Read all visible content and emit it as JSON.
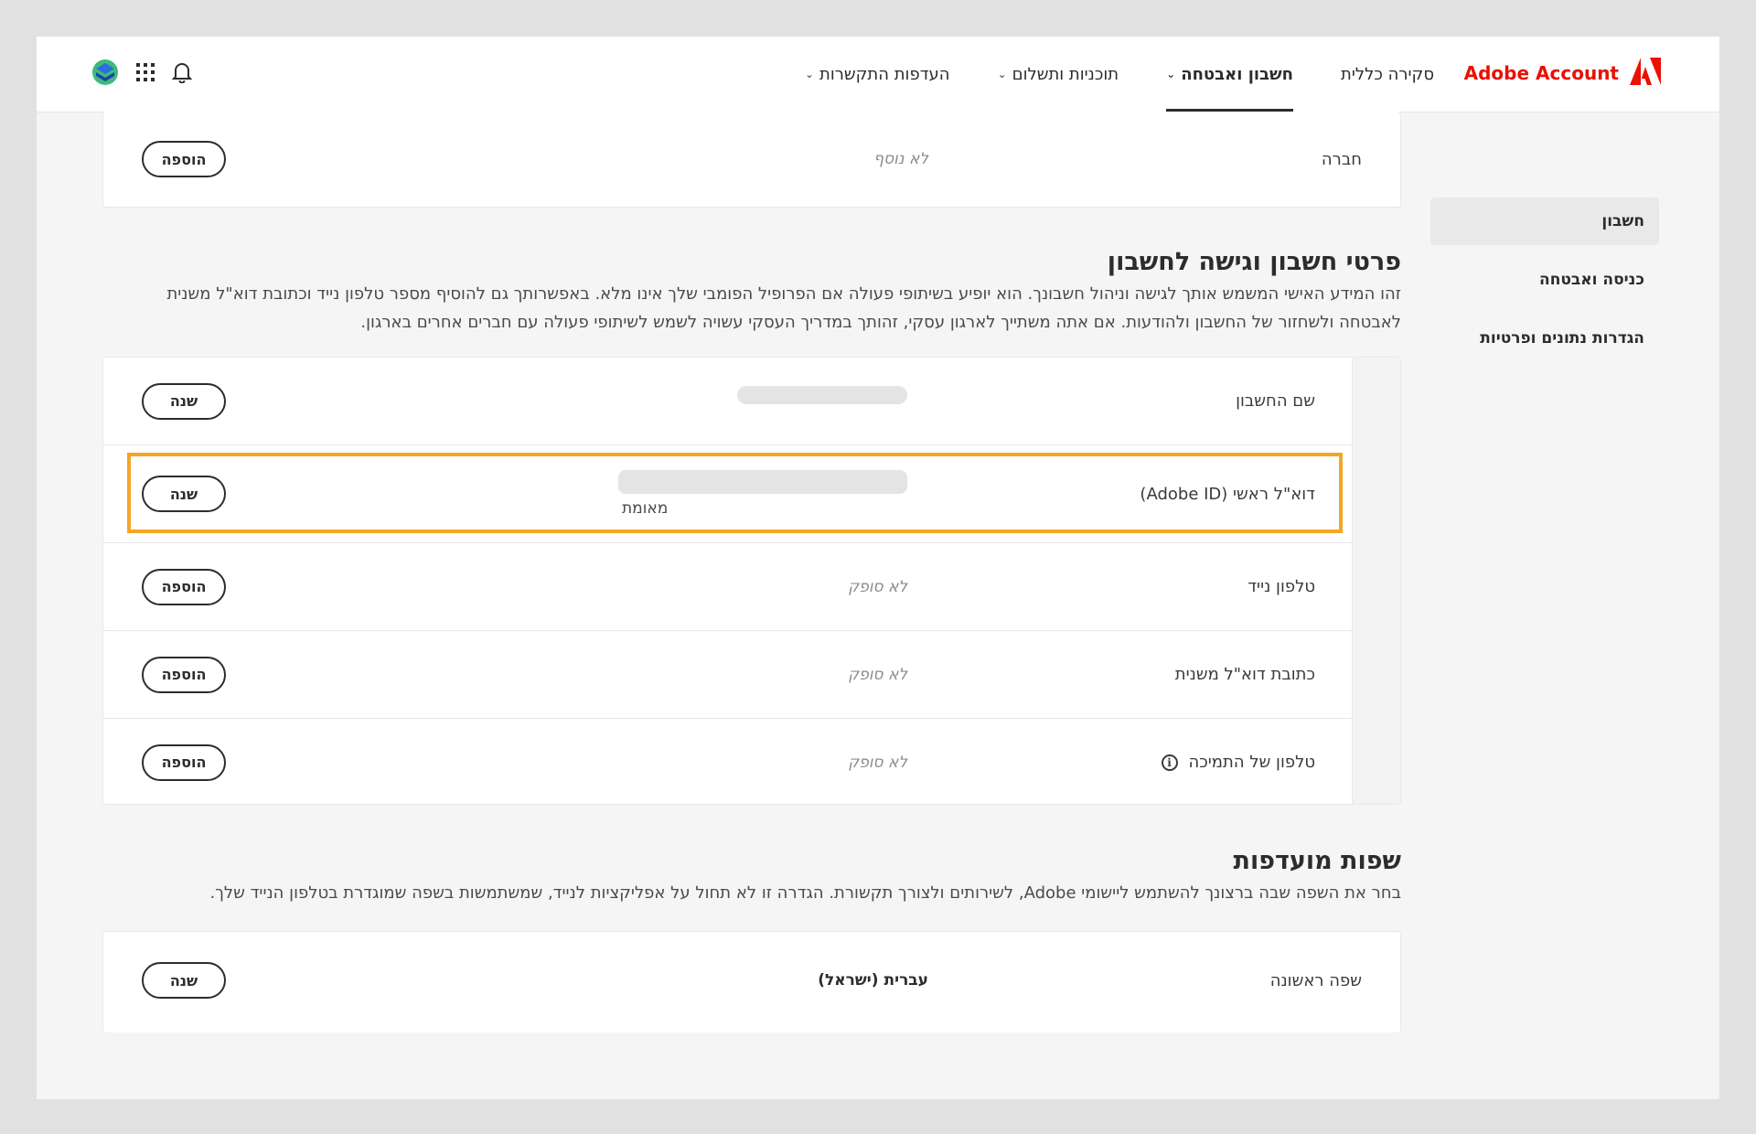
{
  "header": {
    "brand": "Adobe Account",
    "nav": [
      {
        "label": "סקירה כללית",
        "dropdown": false,
        "active": false
      },
      {
        "label": "חשבון ואבטחה",
        "dropdown": true,
        "active": true
      },
      {
        "label": "תוכניות ותשלום",
        "dropdown": true,
        "active": false
      },
      {
        "label": "העדפות התקשרות",
        "dropdown": true,
        "active": false
      }
    ],
    "icons": [
      "bell-icon",
      "apps-grid-icon",
      "avatar"
    ]
  },
  "sidebar": {
    "items": [
      {
        "label": "חשבון",
        "active": true
      },
      {
        "label": "כניסה ואבטחה",
        "active": false
      },
      {
        "label": "הגדרות נתונים ופרטיות",
        "active": false
      }
    ]
  },
  "company_card": {
    "label": "חברה",
    "value": "לא נוסף",
    "button": "הוספה"
  },
  "account_section": {
    "title": "פרטי חשבון וגישה לחשבון",
    "description": "זהו המידע האישי המשמש אותך לגישה וניהול חשבונך. הוא יופיע בשיתופי פעולה אם הפרופיל הפומבי שלך אינו מלא. באפשרותך גם להוסיף מספר טלפון נייד וכתובת דוא\"ל משנית לאבטחה ולשחזור של החשבון ולהודעות. אם אתה משתייך לארגון עסקי, זהותך במדריך העסקי עשויה לשמש לשיתופי פעולה עם חברים אחרים בארגון.",
    "rows": [
      {
        "label": "שם החשבון",
        "value": "",
        "sub": "",
        "button": "שנה"
      },
      {
        "label": "דוא\"ל ראשי (Adobe ID)",
        "value": "",
        "sub": "מאומת",
        "button": "שנה"
      },
      {
        "label": "טלפון נייד",
        "value": "לא סופק",
        "sub": "",
        "button": "הוספה"
      },
      {
        "label": "כתובת דוא\"ל משנית",
        "value": "לא סופק",
        "sub": "",
        "button": "הוספה"
      },
      {
        "label": "טלפון של התמיכה",
        "value": "לא סופק",
        "sub": "",
        "button": "הוספה"
      }
    ]
  },
  "language_section": {
    "title": "שפות מועדפות",
    "description": "בחר את השפה שבה ברצונך להשתמש ליישומי Adobe, לשירותים ולצורך תקשורת. הגדרה זו לא תחול על אפליקציות לנייד, שמשתמשות בשפה שמוגדרת בטלפון הנייד שלך.",
    "row": {
      "label": "שפה ראשונה",
      "value": "עברית (ישראל)",
      "button": "שנה"
    }
  },
  "colors": {
    "brand_red": "#eb1000",
    "highlight": "#f5a623"
  }
}
